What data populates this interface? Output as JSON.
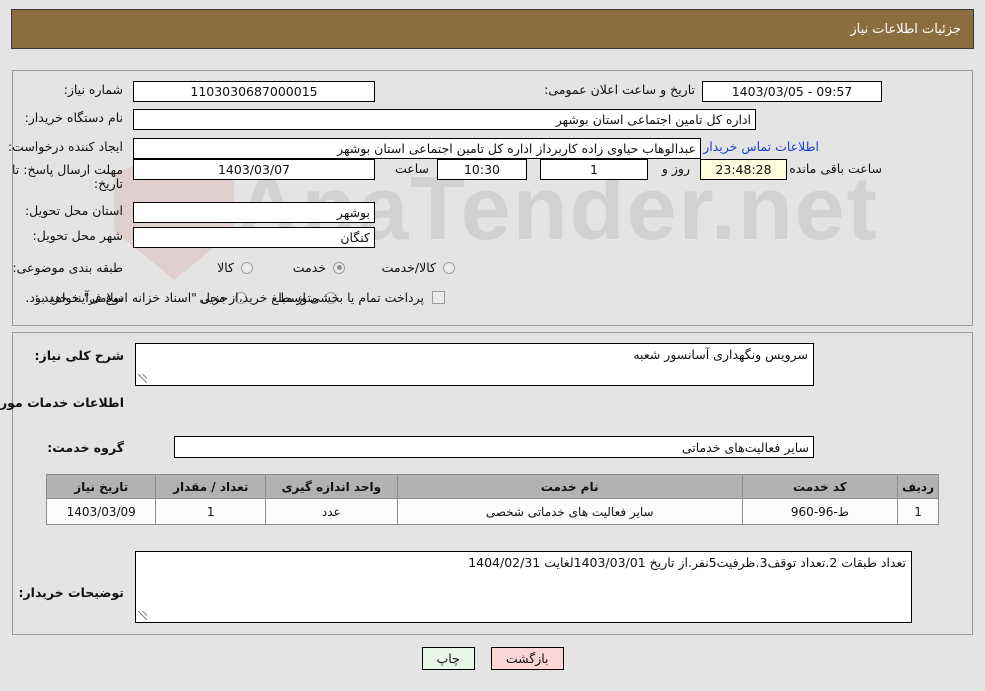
{
  "header": {
    "title": "جزئیات اطلاعات نیاز"
  },
  "top_panel": {
    "need_number_label": "شماره نیاز:",
    "need_number_value": "1103030687000015",
    "announce_label": "تاریخ و ساعت اعلان عمومی:",
    "announce_value": "1403/03/05 - 09:57",
    "buyer_org_label": "نام دستگاه خریدار:",
    "buyer_org_value": "اداره کل تامین اجتماعی استان بوشهر",
    "requester_label": "ایجاد کننده درخواست:",
    "requester_value": "عبدالوهاب  حیاوی زاده  کاربرداز اداره کل تامین اجتماعی استان بوشهر",
    "contact_link": "اطلاعات تماس خریدار",
    "deadline_label": "مهلت ارسال پاسخ: تا تاریخ:",
    "deadline_date": "1403/03/07",
    "time_label": "ساعت",
    "deadline_time": "10:30",
    "days_remaining": "1",
    "days_label": "روز و",
    "countdown": "23:48:28",
    "countdown_label": "ساعت باقی مانده",
    "province_label": "استان محل تحویل:",
    "province_value": "بوشهر",
    "city_label": "شهر محل تحویل:",
    "city_value": "کنگان",
    "category_label": "طبقه بندی موضوعی:",
    "category_options": [
      "کالا",
      "خدمت",
      "کالا/خدمت"
    ],
    "category_selected": "خدمت",
    "process_label": "نوع فرآیند خرید :",
    "process_options": [
      "جزیی",
      "متوسط"
    ],
    "process_selected": "",
    "treasury_checkbox_checked": false,
    "treasury_text": "پرداخت تمام یا بخشی از مبلغ خرید،از محل \"اسناد خزانه اسلامی\" خواهد بود."
  },
  "bottom_panel": {
    "general_desc_label": "شرح کلی نیاز:",
    "general_desc_value": "سرویس ونگهداری آسانسور شعبه",
    "services_info_title": "اطلاعات خدمات مورد نیاز",
    "service_group_label": "گروه خدمت:",
    "service_group_value": "سایر فعالیت‌های خدماتی",
    "table": {
      "columns": [
        "ردیف",
        "کد خدمت",
        "نام خدمت",
        "واحد اندازه گیری",
        "تعداد / مقدار",
        "تاریخ نیاز"
      ],
      "rows": [
        {
          "row_no": "1",
          "service_code": "ط-96-960",
          "service_name": "سایر فعالیت های خدماتی شخصی",
          "unit": "عدد",
          "quantity": "1",
          "need_date": "1403/03/09"
        }
      ]
    },
    "buyer_notes_label": "توضیحات خریدار:",
    "buyer_notes_value": "تعداد طبقات 2.تعداد توقف3.ظرفیت5نفر.از تاریخ 1403/03/01لغایت 1404/02/31"
  },
  "footer": {
    "print_label": "چاپ",
    "back_label": "بازگشت"
  },
  "watermark": {
    "text": "AnaTender.net"
  },
  "colors": {
    "header_bar": "#8c6d3f",
    "page_bg": "#e4e4e4",
    "table_header": "#b2b2b2",
    "link": "#1a3fcf",
    "print_button": "#e8f6e8",
    "back_button": "#fcd5d5",
    "timer_field": "#ffffe0"
  }
}
